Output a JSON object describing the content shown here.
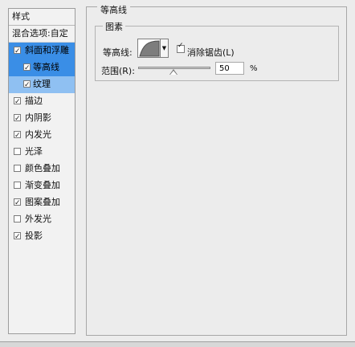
{
  "left_panel": {
    "title": "样式",
    "blend_options": "混合选项:自定",
    "items": [
      {
        "label": "斜面和浮雕",
        "checked": true
      },
      {
        "label": "等高线",
        "checked": true
      },
      {
        "label": "纹理",
        "checked": true
      },
      {
        "label": "描边",
        "checked": true
      },
      {
        "label": "内阴影",
        "checked": true
      },
      {
        "label": "内发光",
        "checked": true
      },
      {
        "label": "光泽",
        "checked": false
      },
      {
        "label": "颜色叠加",
        "checked": false
      },
      {
        "label": "渐变叠加",
        "checked": false
      },
      {
        "label": "图案叠加",
        "checked": true
      },
      {
        "label": "外发光",
        "checked": false
      },
      {
        "label": "投影",
        "checked": true
      }
    ]
  },
  "right_panel": {
    "section_title": "等高线",
    "group_title": "图素",
    "contour_label": "等高线:",
    "anti_alias_label": "消除锯齿(L)",
    "range_label": "范围(R):",
    "range_value": "50",
    "range_unit": "%",
    "range_fraction": 0.5
  },
  "colors": {
    "selection_dark": "#3a8ee6",
    "selection_light": "#8fc0f2",
    "background": "#ececec"
  }
}
